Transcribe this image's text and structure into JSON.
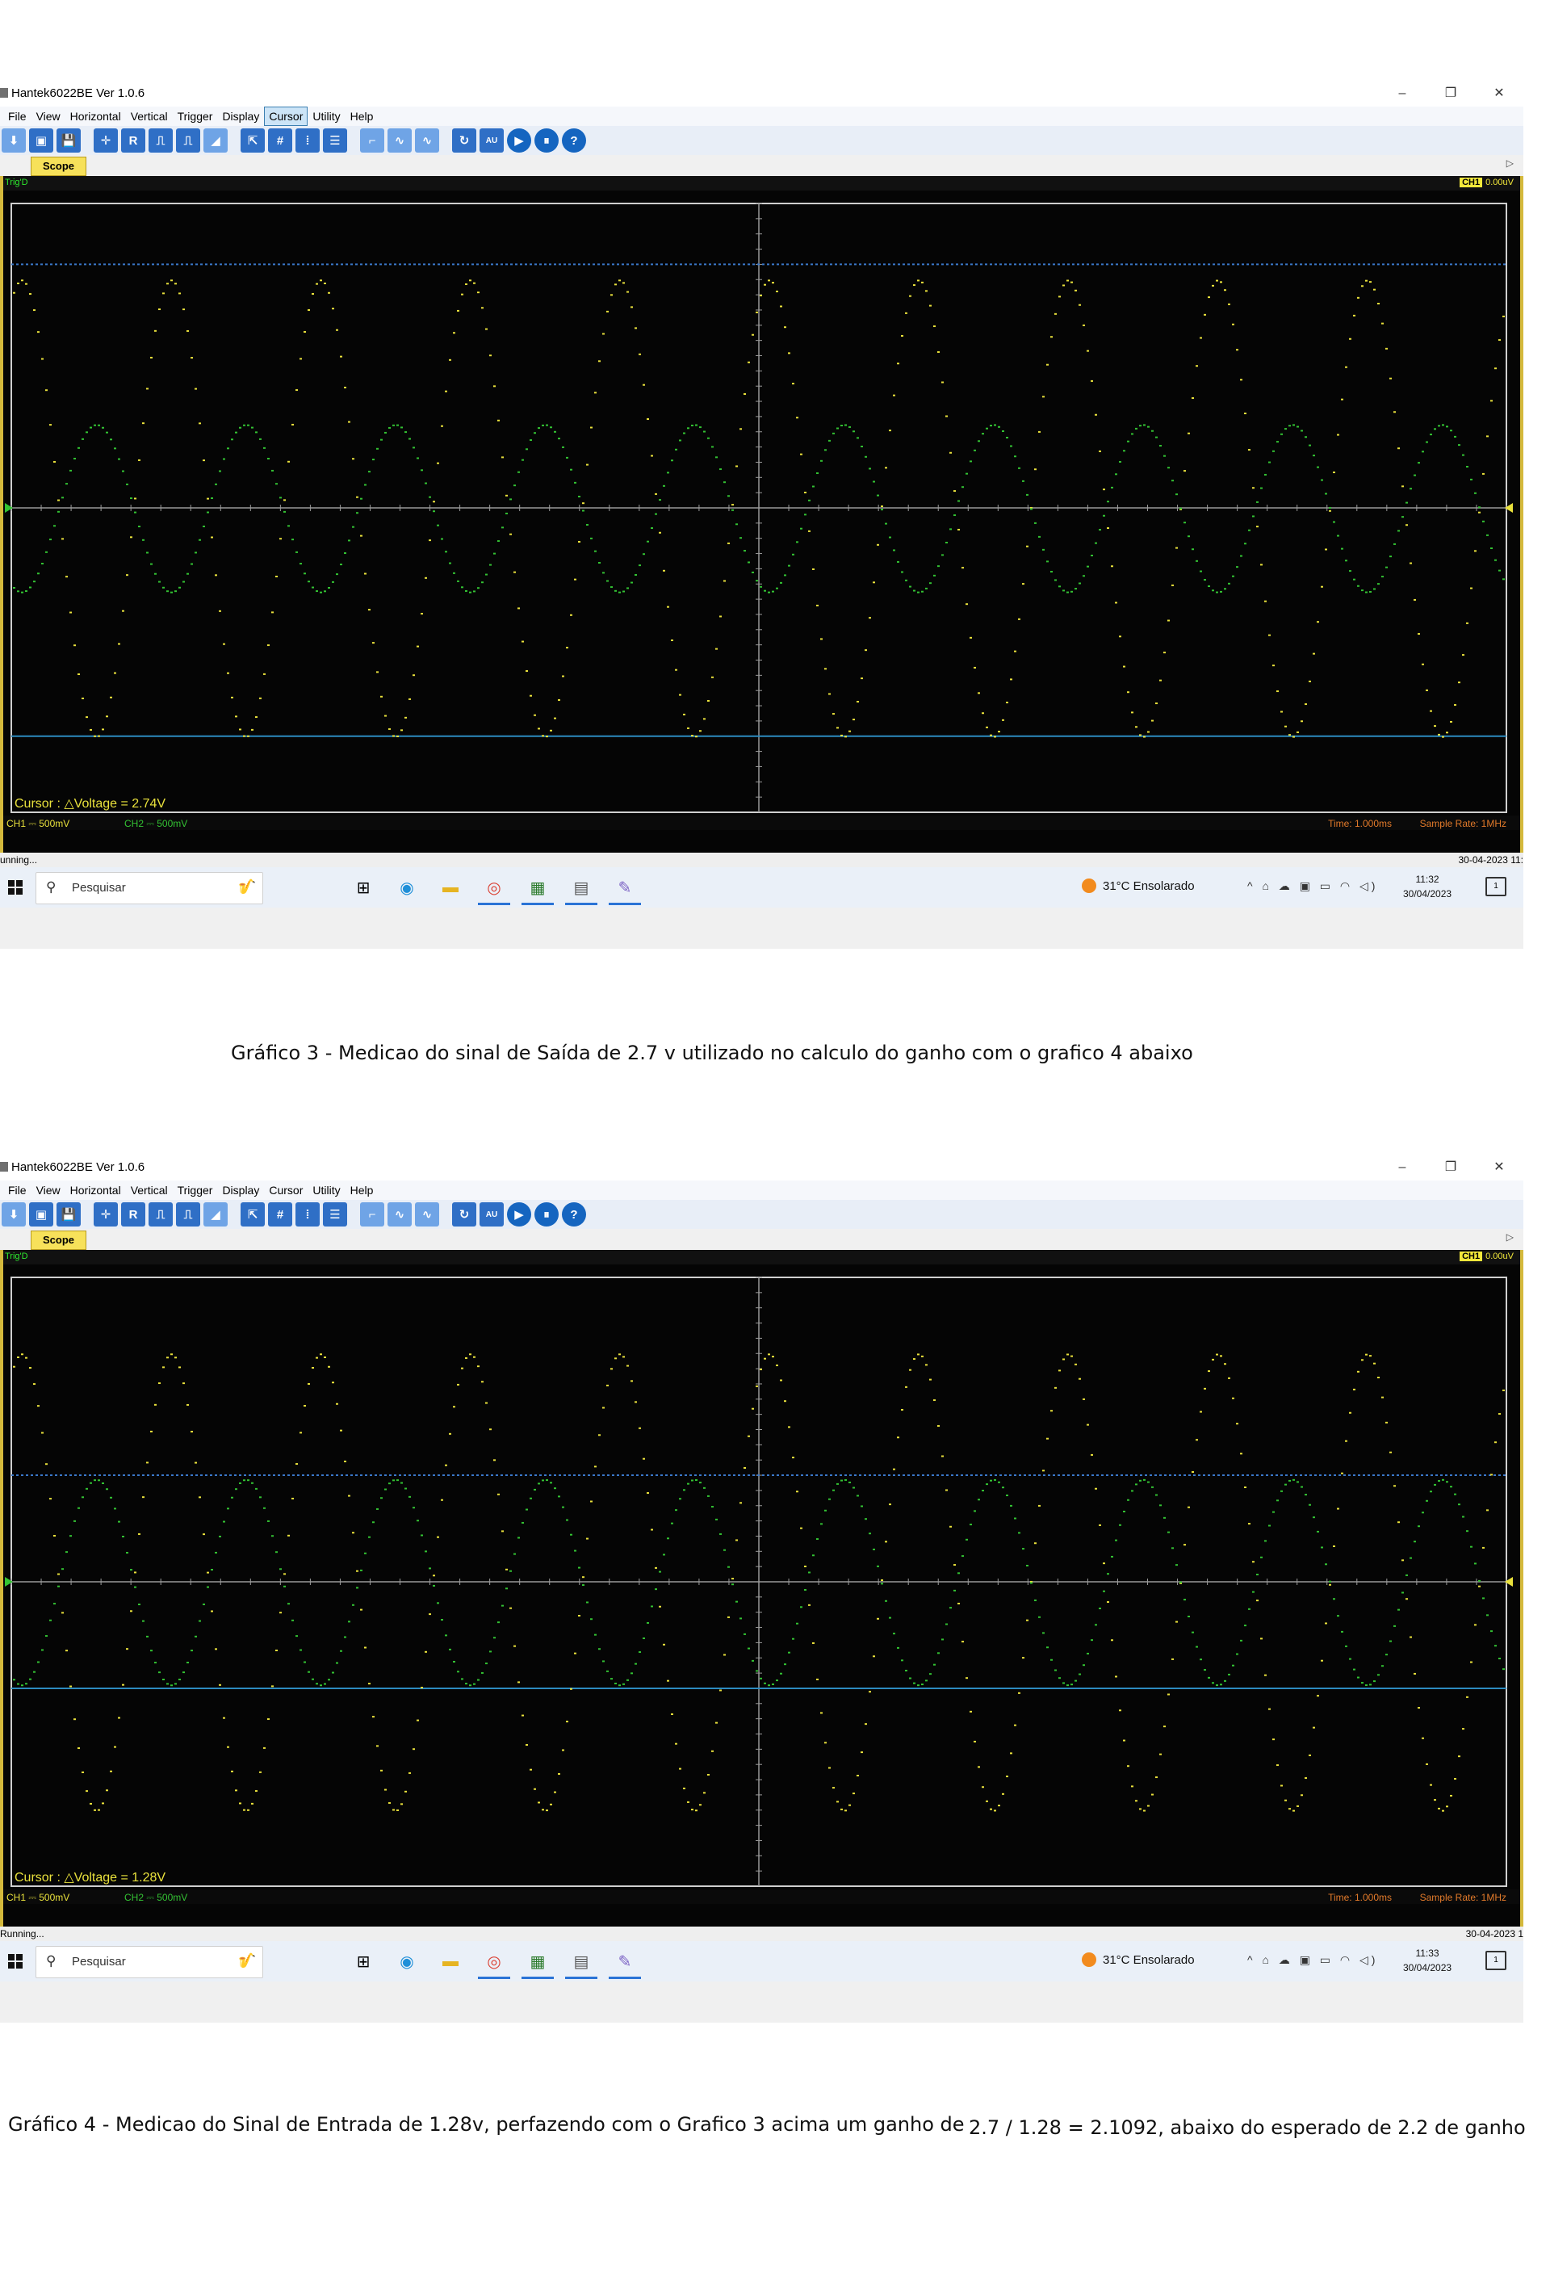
{
  "window": {
    "title": "Hantek6022BE Ver 1.0.6",
    "minimize_icon": "minimize-icon",
    "maximize_icon": "restore-icon",
    "close_icon": "close-icon"
  },
  "menu": [
    "File",
    "View",
    "Horizontal",
    "Vertical",
    "Trigger",
    "Display",
    "Cursor",
    "Utility",
    "Help"
  ],
  "toolbar_glyphs": [
    "⬇",
    "▣",
    "💾",
    "✛",
    "R",
    "⎍",
    "⎍",
    "◢",
    "⇱",
    "#",
    "⁞",
    "☰",
    "⌐",
    "∿",
    "∿",
    "↻",
    "AU",
    "▶",
    "⏸",
    "?"
  ],
  "tab_label": "Scope",
  "scope": {
    "trig_status": "Trig'D",
    "ch1_badge": "CH1",
    "trigger_level": "0.00uV",
    "ch1_scale": "CH1 ⎓  500mV",
    "ch2_scale": "CH2 ⎓  500mV",
    "time_base": "Time: 1.000ms",
    "sample_rate": "Sample Rate: 1MHz",
    "colors": {
      "ch1": "#e9e13c",
      "ch2": "#33c233",
      "cursor_dotted": "#3a78c9",
      "cursor_solid": "#2d8bbf",
      "grid": "#9a9a9a"
    }
  },
  "screenshots": [
    {
      "active_menu": "Cursor",
      "cursor_readout": "Cursor : △Voltage = 2.74V",
      "status_left": "unning...",
      "status_right": "30-04-2023  11:",
      "clock_time": "11:32",
      "clock_date": "30/04/2023",
      "ch1_amplitude_div": 3.0,
      "ch2_amplitude_div": 1.1,
      "cursor_a_div": 3.2,
      "cursor_b_div": -3.0
    },
    {
      "active_menu": "",
      "cursor_readout": "Cursor : △Voltage = 1.28V",
      "status_left": "Running...",
      "status_right": "30-04-2023  1",
      "clock_time": "11:33",
      "clock_date": "30/04/2023",
      "ch1_amplitude_div": 3.0,
      "ch2_amplitude_div": 1.35,
      "cursor_a_div": 1.4,
      "cursor_b_div": -1.4
    }
  ],
  "taskbar": {
    "search_placeholder": "Pesquisar",
    "weather": "31°C  Ensolarado",
    "tray_icons": "^ ⌂ ☁ ▣ ▭ ◠ ◁)",
    "notif_count": "1",
    "apps": [
      "⊞",
      "◉",
      "▬",
      "◎",
      "▦",
      "▤",
      "✎"
    ]
  },
  "captions": {
    "grafico3": "Gráfico 3 - Medicao do sinal de Saída de 2.7 v utilizado no calculo do ganho com o grafico 4 abaixo",
    "grafico4_part1": "Gráfico 4 - Medicao do Sinal de Entrada de 1.28v, perfazendo com o Grafico 3 acima um ganho de",
    "grafico4_part2": "2.7 / 1.28 = 2.1092, abaixo do esperado de 2.2 de ganho"
  }
}
